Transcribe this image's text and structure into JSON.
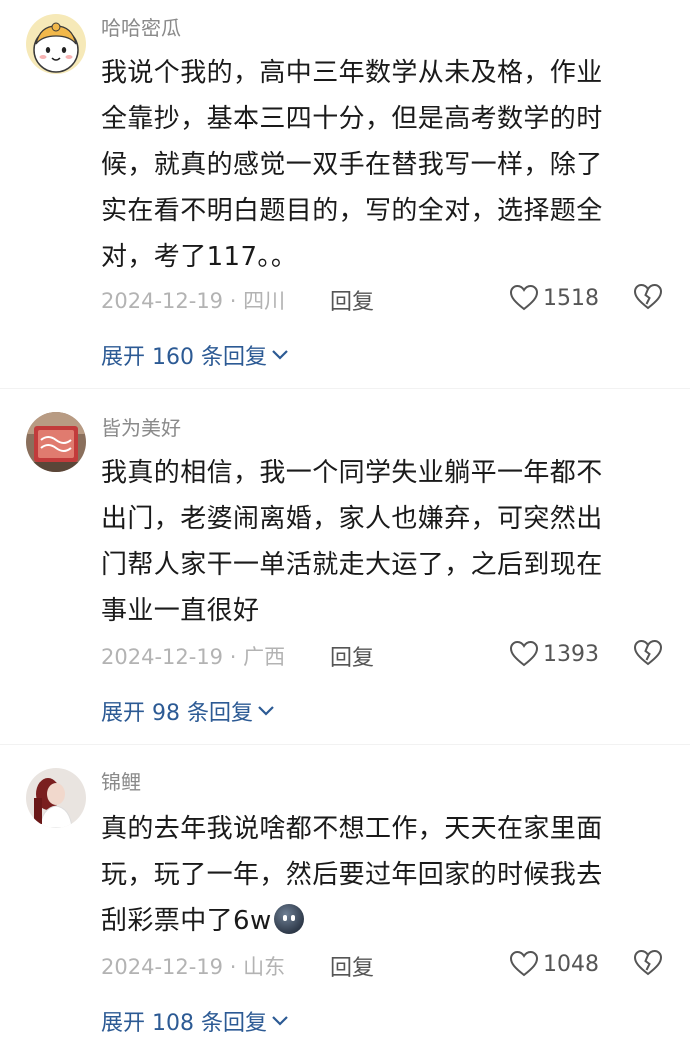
{
  "comments": [
    {
      "username": "哈哈密瓜",
      "lines": [
        "我说个我的，高中三年数学从未及格，作业",
        "全靠抄，基本三四十分，但是高考数学的时",
        "候，就真的感觉一双手在替我写一样，除了",
        "实在看不明白题目的，写的全对，选择题全",
        "对，考了117。。"
      ],
      "date_location": "2024-12-19 · 四川",
      "reply_label": "回复",
      "likes": "1518",
      "expand_label": "展开 160 条回复",
      "avatar_icon": "cartoon-sheep-avatar"
    },
    {
      "username": "皆为美好",
      "lines": [
        "我真的相信，我一个同学失业躺平一年都不",
        "出门，老婆闹离婚，家人也嫌弃，可突然出",
        "门帮人家干一单活就走大运了，之后到现在",
        "事业一直很好"
      ],
      "date_location": "2024-12-19 · 广西",
      "reply_label": "回复",
      "likes": "1393",
      "expand_label": "展开 98 条回复",
      "avatar_icon": "red-sign-photo-avatar"
    },
    {
      "username": "锦鲤",
      "lines": [
        "真的去年我说啥都不想工作，天天在家里面",
        "玩，玩了一年，然后要过年回家的时候我去",
        "刮彩票中了6w"
      ],
      "date_location": "2024-12-19 · 山东",
      "reply_label": "回复",
      "likes": "1048",
      "expand_label": "展开 108 条回复",
      "avatar_icon": "person-photo-avatar",
      "trailing_emoji": "dark-face-emoji"
    }
  ],
  "colors": {
    "username": "#8a8a8a",
    "body": "#1a1a1a",
    "meta": "#b3b3b3",
    "action": "#555555",
    "expand_link": "#2c5a94"
  },
  "icons": {
    "like": "heart-outline-icon",
    "dislike": "broken-heart-icon",
    "expand": "chevron-down-icon"
  }
}
